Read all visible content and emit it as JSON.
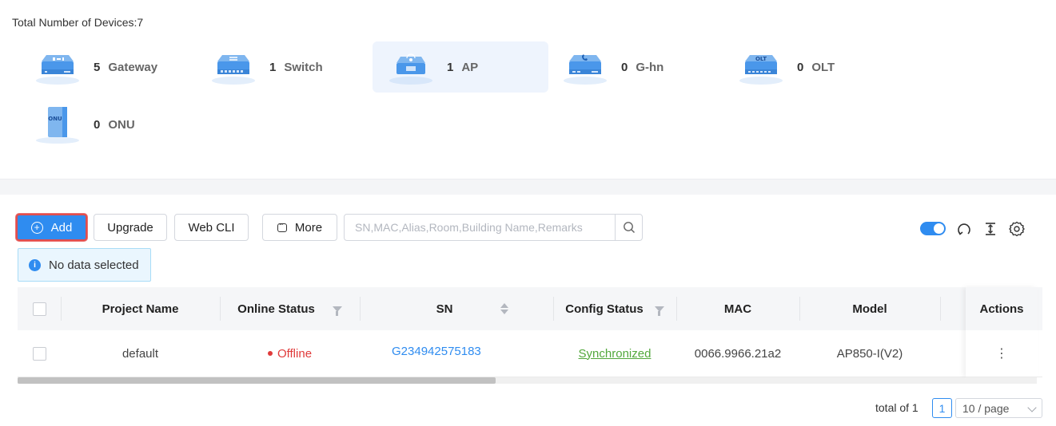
{
  "summary": {
    "total_label": "Total Number of Devices:7"
  },
  "devices": [
    {
      "count": "5",
      "label": "Gateway",
      "icon": "gateway-icon"
    },
    {
      "count": "1",
      "label": "Switch",
      "icon": "switch-icon"
    },
    {
      "count": "1",
      "label": "AP",
      "icon": "ap-icon"
    },
    {
      "count": "0",
      "label": "G-hn",
      "icon": "ghn-icon"
    },
    {
      "count": "0",
      "label": "OLT",
      "icon": "olt-icon"
    },
    {
      "count": "0",
      "label": "ONU",
      "icon": "onu-icon"
    }
  ],
  "device_icon_text": {
    "olt": "OLT",
    "onu": "ONU"
  },
  "toolbar": {
    "add_label": "Add",
    "upgrade_label": "Upgrade",
    "webcli_label": "Web CLI",
    "more_label": "More",
    "search_placeholder": "SN,MAC,Alias,Room,Building Name,Remarks"
  },
  "notice": {
    "text": "No data selected"
  },
  "table": {
    "columns": [
      "Project Name",
      "Online Status",
      "SN",
      "Config Status",
      "MAC",
      "Model",
      "Actions"
    ],
    "rows": [
      {
        "project": "default",
        "status": "Offline",
        "sn": "G234942575183",
        "config": "Synchronized",
        "mac": "0066.9966.21a2",
        "model": "AP850-I(V2)",
        "actions": "⋮"
      }
    ]
  },
  "pagination": {
    "total": "total of 1",
    "page": "1",
    "page_size": "10 / page"
  },
  "colors": {
    "accent": "#2f8cf0",
    "offline": "#e03a3a",
    "synchronized": "#52a83c"
  }
}
